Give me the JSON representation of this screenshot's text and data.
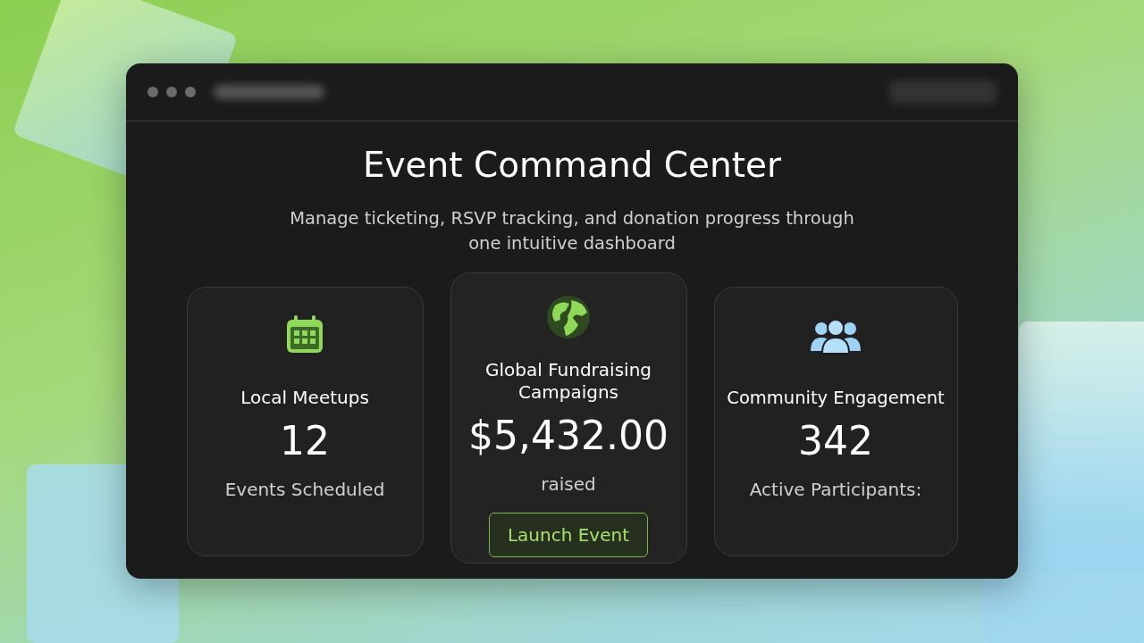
{
  "window": {
    "title": "Event Command Center",
    "subtitle": "Manage ticketing, RSVP tracking, and donation progress through one intuitive dashboard"
  },
  "cards": [
    {
      "kind": "meetups",
      "title": "Local Meetups",
      "value": "12",
      "caption": "Events Scheduled"
    },
    {
      "kind": "fundraising",
      "title": "Global Fundraising Campaigns",
      "value": "$5,432.00",
      "caption": "raised",
      "button": "Launch Event"
    },
    {
      "kind": "community",
      "title": "Community Engagement",
      "value": "342",
      "caption": "Active Participants:"
    }
  ]
}
